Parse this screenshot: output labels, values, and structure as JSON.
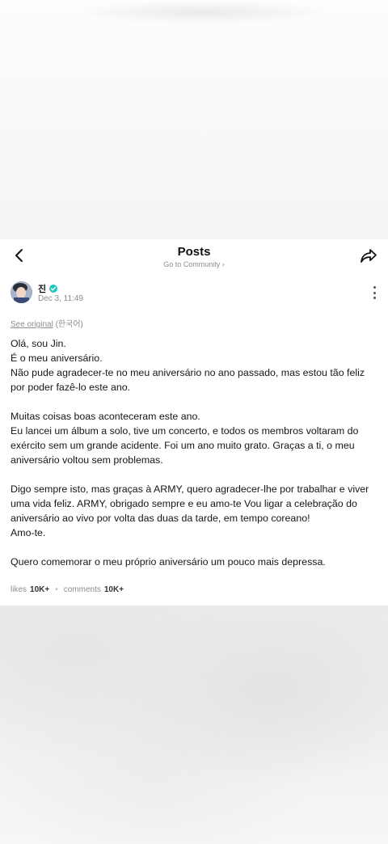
{
  "header": {
    "title": "Posts",
    "subtitle": "Go to Community",
    "subtitle_chevron": "›"
  },
  "author": {
    "name": "진",
    "date": "Dec 3, 11:49",
    "verified_color": "#1ec7c0"
  },
  "translation": {
    "link_label": "See original",
    "language": "(한국어)"
  },
  "post": {
    "paragraphs": [
      [
        "Olá, sou Jin.",
        "É o meu aniversário.",
        "Não pude agradecer-te no meu aniversário no ano passado, mas estou tão feliz por poder fazê-lo este ano."
      ],
      [
        "Muitas coisas boas aconteceram este ano.",
        "Eu lancei um álbum a solo, tive um concerto, e todos os membros voltaram do exército sem um grande acidente. Foi um ano muito grato. Graças a ti, o meu aniversário voltou sem problemas."
      ],
      [
        "Digo sempre isto, mas graças à ARMY, quero agradecer-lhe por trabalhar e viver uma vida feliz. ARMY, obrigado sempre e eu amo-te Vou ligar a celebração do aniversário ao vivo por volta das duas da tarde, em tempo coreano!",
        "Amo-te."
      ],
      [
        "Quero comemorar o meu próprio aniversário um pouco mais depressa."
      ]
    ]
  },
  "stats": {
    "likes_label": "likes",
    "likes_value": "10K+",
    "separator": "•",
    "comments_label": "comments",
    "comments_value": "10K+"
  },
  "icons": {
    "back": "back-arrow-icon",
    "share": "share-icon",
    "more": "more-vertical-icon",
    "verified": "verified-badge-icon"
  }
}
